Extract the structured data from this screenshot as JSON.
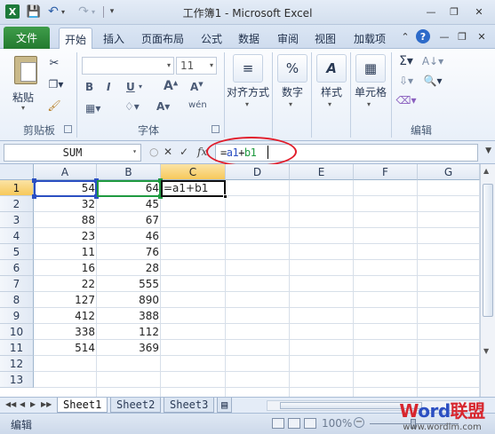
{
  "titlebar": {
    "window_title": "工作簿1 - Microsoft Excel",
    "logo_letter": "X"
  },
  "tabs": {
    "file": "文件",
    "items": [
      "开始",
      "插入",
      "页面布局",
      "公式",
      "数据",
      "审阅",
      "视图",
      "加载项"
    ],
    "active": "开始"
  },
  "ribbon": {
    "clipboard": {
      "paste": "粘贴",
      "group_label": "剪贴板"
    },
    "font": {
      "size": "11",
      "group_label": "字体"
    },
    "alignment": {
      "label": "对齐方式"
    },
    "number": {
      "label": "数字"
    },
    "styles": {
      "label": "样式"
    },
    "cells": {
      "label": "单元格"
    },
    "editing": {
      "group_label": "编辑"
    }
  },
  "formula_bar": {
    "name_box": "SUM",
    "formula": "=a1+b1",
    "formula_a1": "a1",
    "formula_b1": "b1"
  },
  "grid": {
    "columns": [
      "A",
      "B",
      "C",
      "D",
      "E",
      "F",
      "G"
    ],
    "rows": [
      "1",
      "2",
      "3",
      "4",
      "5",
      "6",
      "7",
      "8",
      "9",
      "10",
      "11",
      "12",
      "13"
    ],
    "col_a": [
      "54",
      "32",
      "88",
      "23",
      "11",
      "16",
      "22",
      "127",
      "412",
      "338",
      "514"
    ],
    "col_b": [
      "64",
      "45",
      "67",
      "46",
      "76",
      "28",
      "555",
      "890",
      "388",
      "112",
      "369"
    ],
    "c1": "=a1+b1",
    "active_cell": "C1"
  },
  "sheets": {
    "tabs": [
      "Sheet1",
      "Sheet2",
      "Sheet3"
    ],
    "active": "Sheet1"
  },
  "status": {
    "mode": "编辑",
    "zoom": "100%"
  },
  "watermark": {
    "brand": "Word联盟",
    "url": "www.wordlm.com"
  }
}
